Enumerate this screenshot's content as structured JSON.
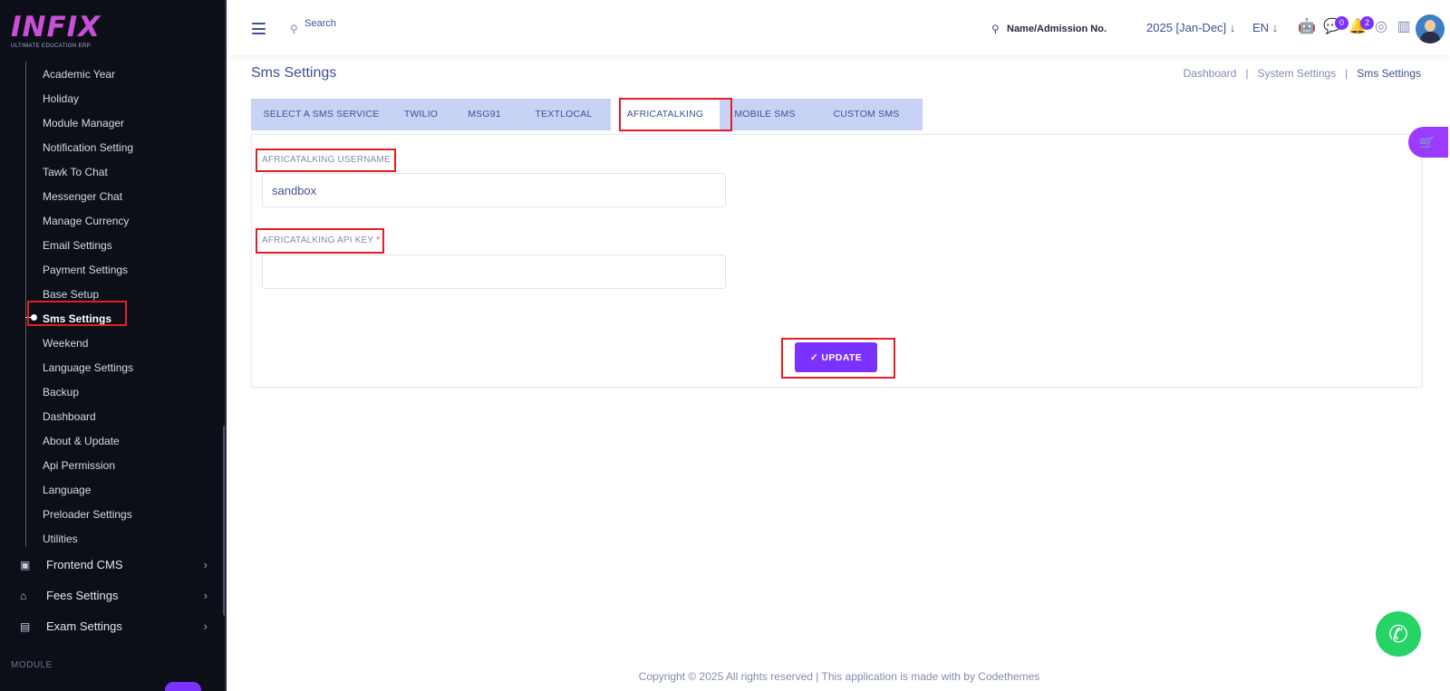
{
  "brand": {
    "logo_main": "INFIX",
    "logo_sub": "ULTIMATE EDUCATION ERP"
  },
  "sidebar": {
    "items": [
      {
        "label": "Academic Year"
      },
      {
        "label": "Holiday"
      },
      {
        "label": "Module Manager"
      },
      {
        "label": "Notification Setting"
      },
      {
        "label": "Tawk To Chat"
      },
      {
        "label": "Messenger Chat"
      },
      {
        "label": "Manage Currency"
      },
      {
        "label": "Email Settings"
      },
      {
        "label": "Payment Settings"
      },
      {
        "label": "Base Setup"
      },
      {
        "label": "Sms Settings"
      },
      {
        "label": "Weekend"
      },
      {
        "label": "Language Settings"
      },
      {
        "label": "Backup"
      },
      {
        "label": "Dashboard"
      },
      {
        "label": "About & Update"
      },
      {
        "label": "Api Permission"
      },
      {
        "label": "Language"
      },
      {
        "label": "Preloader Settings"
      },
      {
        "label": "Utilities"
      }
    ],
    "active_item": "Sms Settings",
    "sections": [
      {
        "label": "Frontend CMS",
        "icon": "monitor-icon"
      },
      {
        "label": "Fees Settings",
        "icon": "bank-icon"
      },
      {
        "label": "Exam Settings",
        "icon": "book-icon"
      }
    ],
    "module_label": "MODULE"
  },
  "topbar": {
    "search_placeholder": "Search",
    "admission_search": "Name/Admission No.",
    "year": "2025 [Jan-Dec]",
    "language": "EN",
    "chat_badge": "0",
    "notification_badge": "2"
  },
  "page": {
    "title": "Sms Settings",
    "breadcrumb": [
      "Dashboard",
      "System Settings",
      "Sms Settings"
    ]
  },
  "tabs": [
    {
      "label": "SELECT A SMS SERVICE"
    },
    {
      "label": "TWILIO"
    },
    {
      "label": "MSG91"
    },
    {
      "label": "TEXTLOCAL"
    },
    {
      "label": "AFRICATALKING"
    },
    {
      "label": "MOBILE SMS"
    },
    {
      "label": "CUSTOM SMS"
    }
  ],
  "active_tab": "AFRICATALKING",
  "form": {
    "username_label": "AFRICATALKING USERNAME",
    "username_value": "sandbox",
    "apikey_label": "AFRICATALKING API KEY",
    "apikey_value": "",
    "required_mark": "*",
    "update_label": "UPDATE",
    "update_icon": "✓"
  },
  "footer": {
    "text": "Copyright © 2025 All rights reserved | This application is made with by Codethemes"
  },
  "colors": {
    "accent": "#7c32ff",
    "sidebar_bg": "#0c0f17",
    "tab_bg": "#c8d2f5",
    "highlight": "#e31e24",
    "whatsapp": "#25d366"
  }
}
